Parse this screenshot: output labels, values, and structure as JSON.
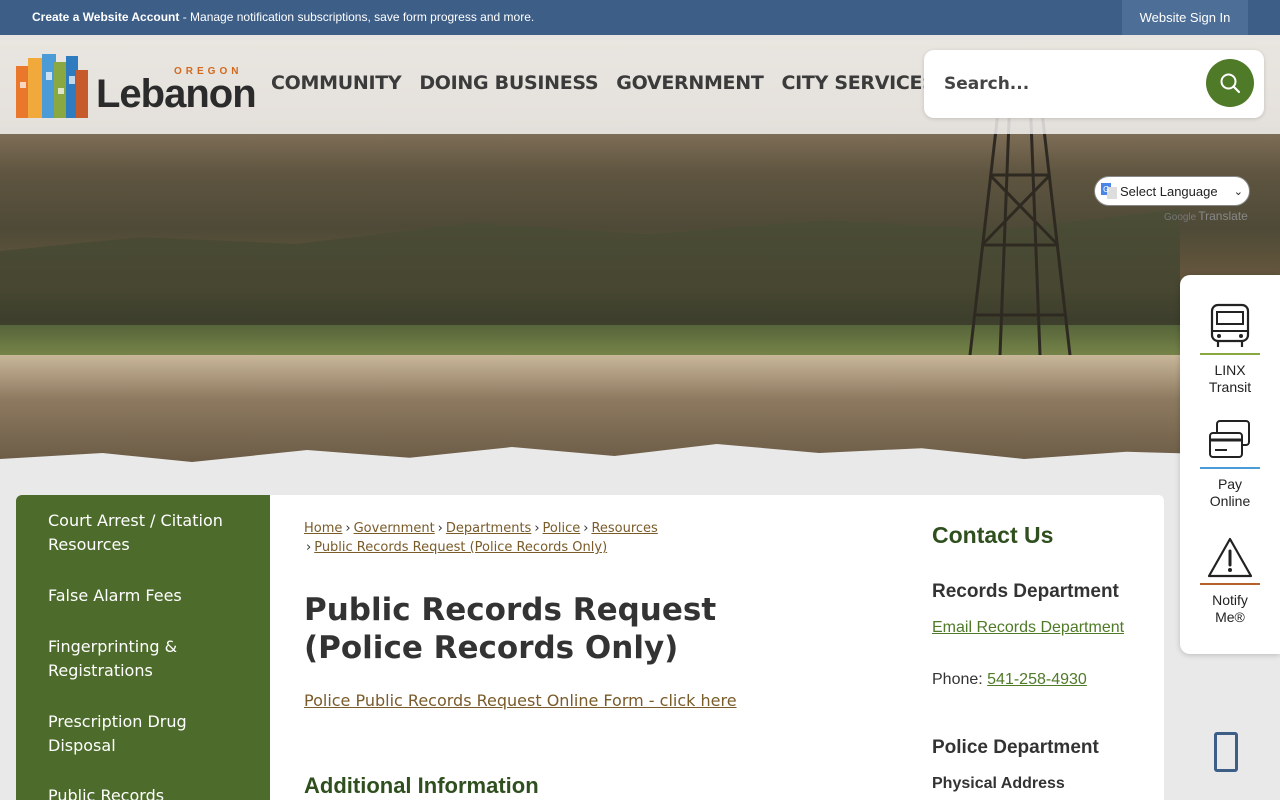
{
  "topbar": {
    "account_bold": "Create a Website Account",
    "account_rest": " - Manage notification subscriptions, save form progress and more.",
    "signin": "Website Sign In"
  },
  "logo": {
    "state": "OREGON",
    "name": "Lebanon"
  },
  "nav": [
    "COMMUNITY",
    "DOING BUSINESS",
    "GOVERNMENT",
    "CITY SERVICES"
  ],
  "search": {
    "placeholder": "Search..."
  },
  "translate": {
    "label": "Select Language",
    "powered_google": "Google",
    "powered_translate": "Translate"
  },
  "quick_links": [
    {
      "label1": "LINX",
      "label2": "Transit",
      "icon": "bus-icon",
      "color": "#8aa842"
    },
    {
      "label1": "Pay",
      "label2": "Online",
      "icon": "credit-card-icon",
      "color": "#4a9bd6"
    },
    {
      "label1": "Notify",
      "label2": "Me®",
      "icon": "alert-icon",
      "color": "#b5622a"
    }
  ],
  "sidebar": [
    "Court Arrest / Citation Resources",
    "False Alarm Fees",
    "Fingerprinting & Registrations",
    "Prescription Drug Disposal",
    "Public Records"
  ],
  "breadcrumb": {
    "items": [
      "Home",
      "Government",
      "Departments",
      "Police",
      "Resources"
    ],
    "current": "Public Records Request (Police Records Only)"
  },
  "page": {
    "title": "Public Records Request (Police Records Only)",
    "form_link": "Police Public Records Request Online Form - click here",
    "additional": "Additional Information"
  },
  "contact": {
    "heading": "Contact Us",
    "records_dept": "Records Department",
    "email_link": "Email Records Department",
    "phone_label": "Phone: ",
    "phone": "541-258-4930",
    "police_dept": "Police Department",
    "physical_address": "Physical Address"
  },
  "colors": {
    "topbar": "#3d5e87",
    "green": "#4d6b2b",
    "accent_link": "#7a5b2a"
  }
}
